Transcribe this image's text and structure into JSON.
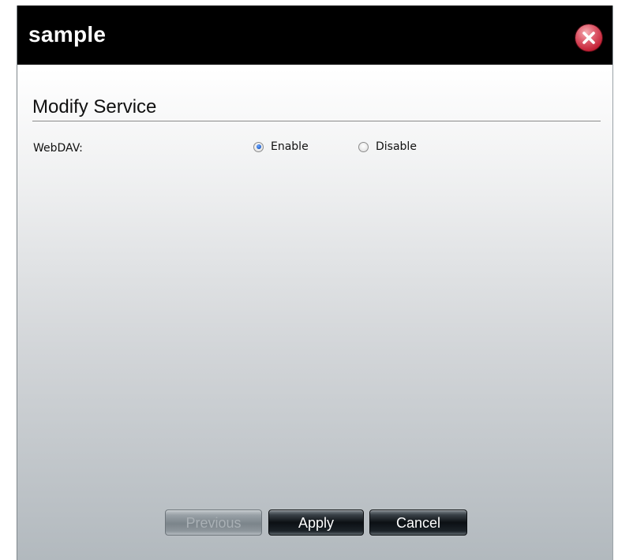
{
  "window": {
    "title": "sample"
  },
  "section": {
    "title": "Modify Service"
  },
  "webdav": {
    "label": "WebDAV:",
    "options": [
      {
        "label": "Enable",
        "checked": true
      },
      {
        "label": "Disable",
        "checked": false
      }
    ]
  },
  "buttons": {
    "previous": {
      "label": "Previous",
      "enabled": false
    },
    "apply": {
      "label": "Apply",
      "enabled": true
    },
    "cancel": {
      "label": "Cancel",
      "enabled": true
    }
  },
  "icons": {
    "close": "close-icon",
    "radio_selected": "radio-selected-icon",
    "radio_unselected": "radio-unselected-icon"
  },
  "colors": {
    "titlebar": "#000000",
    "title_text": "#ffffff",
    "close_button": "#c21f34",
    "button_dark": "#0c1014",
    "button_disabled": "#7b848a"
  }
}
